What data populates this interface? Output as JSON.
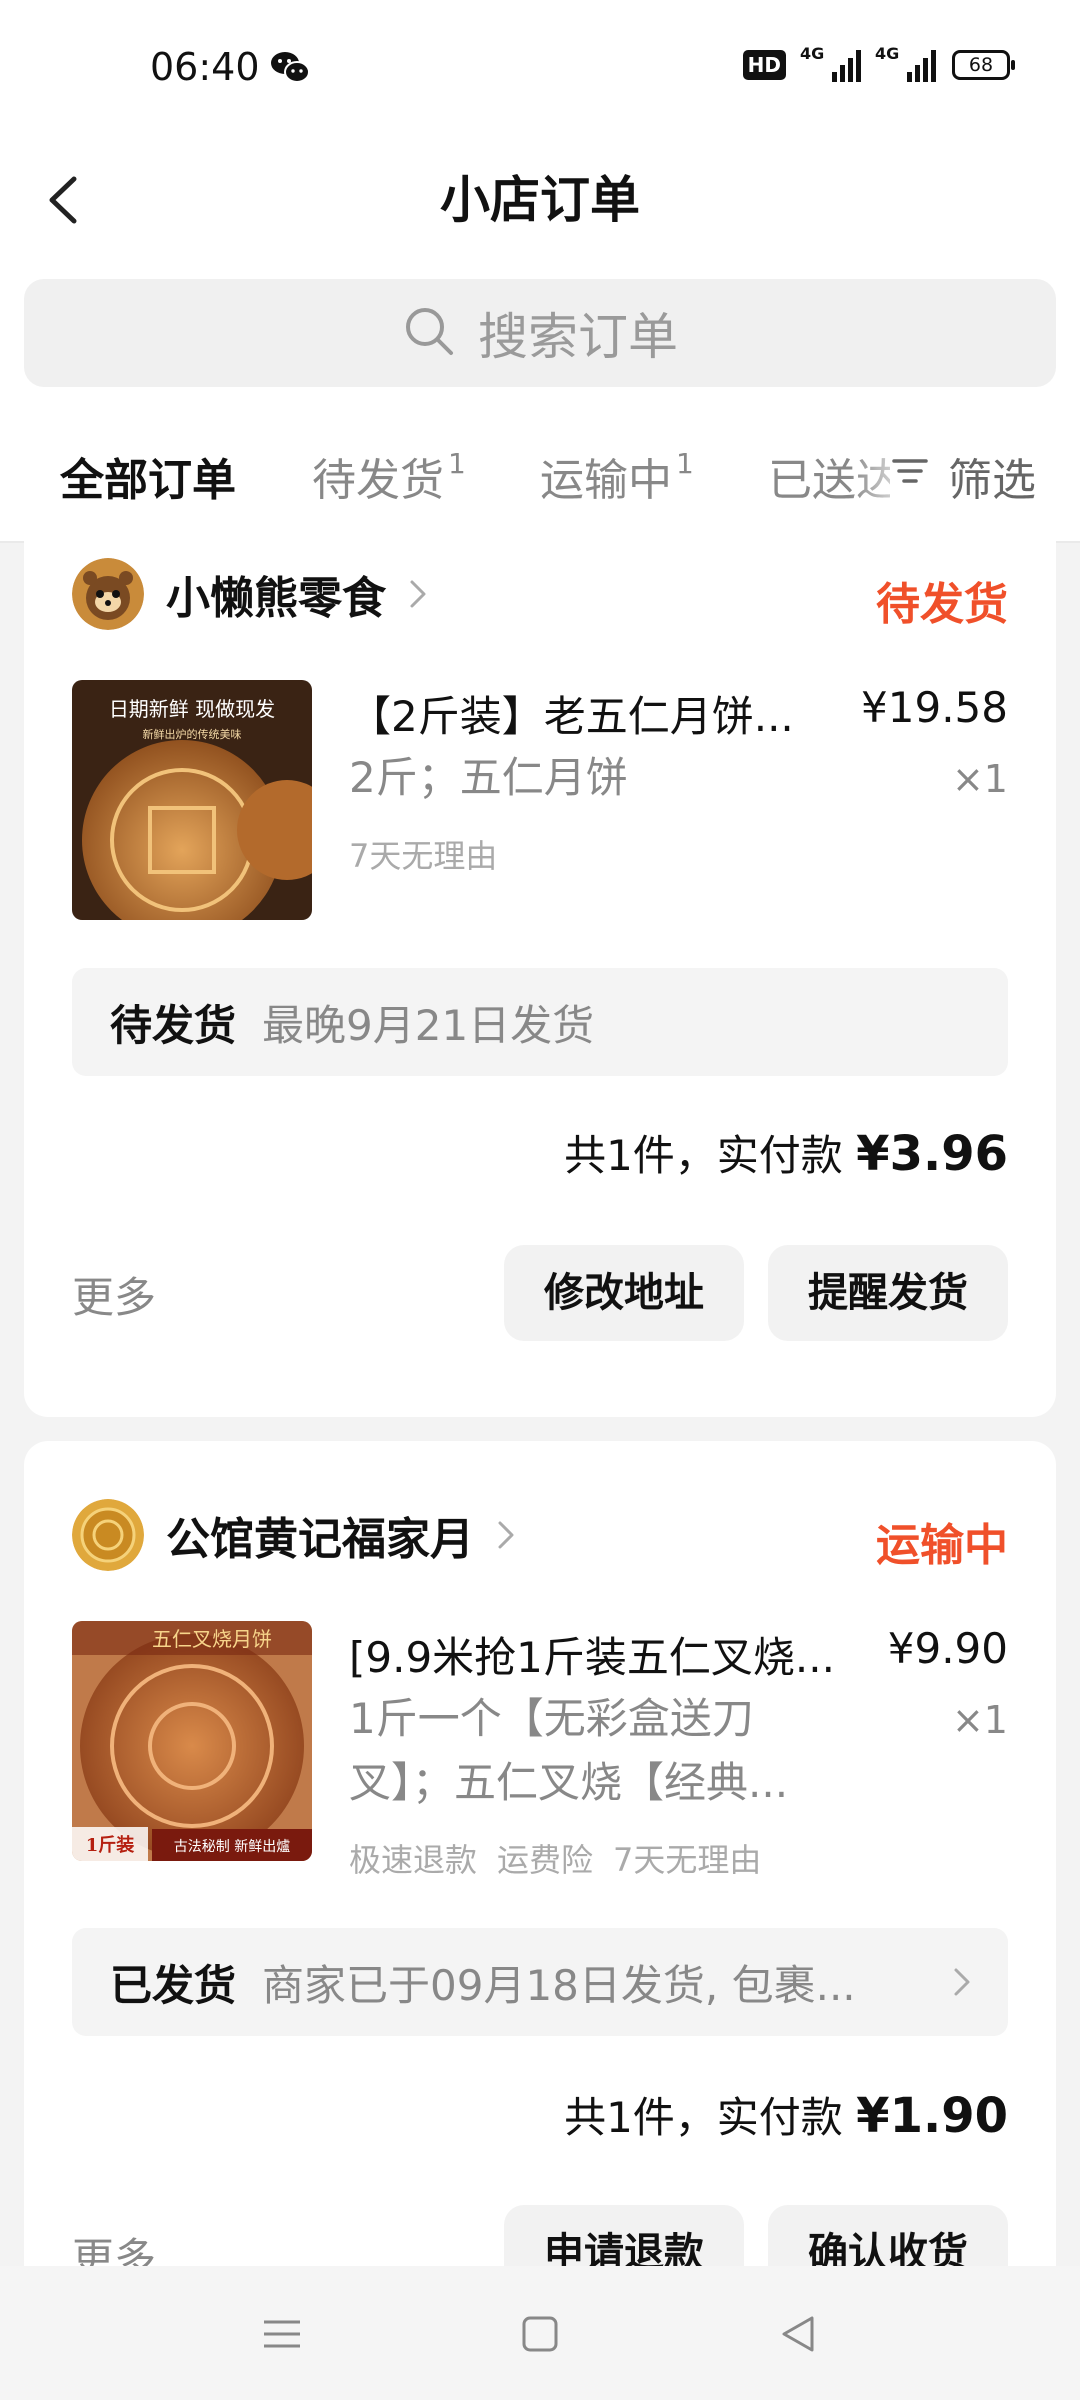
{
  "status_bar": {
    "time": "06:40",
    "hd_badge": "HD",
    "signal1_label": "4G",
    "signal2_label": "4G",
    "battery": "68"
  },
  "header": {
    "title": "小店订单",
    "back_icon": "chevron-left-icon"
  },
  "search": {
    "placeholder": "搜索订单",
    "icon": "search-icon"
  },
  "tabs": [
    {
      "label": "全部订单",
      "count": "",
      "active": true
    },
    {
      "label": "待发货",
      "count": "1",
      "active": false
    },
    {
      "label": "运输中",
      "count": "1",
      "active": false
    },
    {
      "label": "已送达",
      "count": "",
      "active": false
    }
  ],
  "filter": {
    "label": "筛选",
    "icon": "filter-icon"
  },
  "orders": [
    {
      "shop_name": "小懒熊零食",
      "status": "待发货",
      "product_title": "【2斤装】老五仁月饼...",
      "price": "¥19.58",
      "spec": "2斤；五仁月饼",
      "quantity": "×1",
      "tags": [
        "7天无理由"
      ],
      "image_banner": "日期新鲜 现做现发",
      "image_subtext": "新鲜出炉的传统美味",
      "status_box_label": "待发货",
      "status_box_text": "最晚9月21日发货",
      "total_prefix": "共1件，实付款",
      "total_amount": "¥3.96",
      "more_label": "更多",
      "actions": [
        "修改地址",
        "提醒发货"
      ]
    },
    {
      "shop_name": "公馆黄记福家月",
      "status": "运输中",
      "product_title": "[9.9米抢1斤装五仁叉烧...",
      "price": "¥9.90",
      "spec": "1斤一个【无彩盒送刀叉】；五仁叉烧【经典...",
      "quantity": "×1",
      "tags": [
        "极速退款",
        "运费险",
        "7天无理由"
      ],
      "image_banner": "五仁叉烧月饼",
      "image_tag_left": "1斤装",
      "image_tag_right": "古法秘制 新鲜出爐",
      "status_box_label": "已发货",
      "status_box_text": "商家已于09月18日发货, 包裹...",
      "total_prefix": "共1件，实付款",
      "total_amount": "¥1.90",
      "more_label": "更多",
      "actions": [
        "申请退款",
        "确认收货"
      ]
    }
  ],
  "nav_bar": {
    "icons": [
      "menu-icon",
      "home-square-icon",
      "back-triangle-icon"
    ]
  },
  "colors": {
    "accent_status": "#f0502a",
    "background": "#f3f3f3",
    "card": "#ffffff"
  }
}
